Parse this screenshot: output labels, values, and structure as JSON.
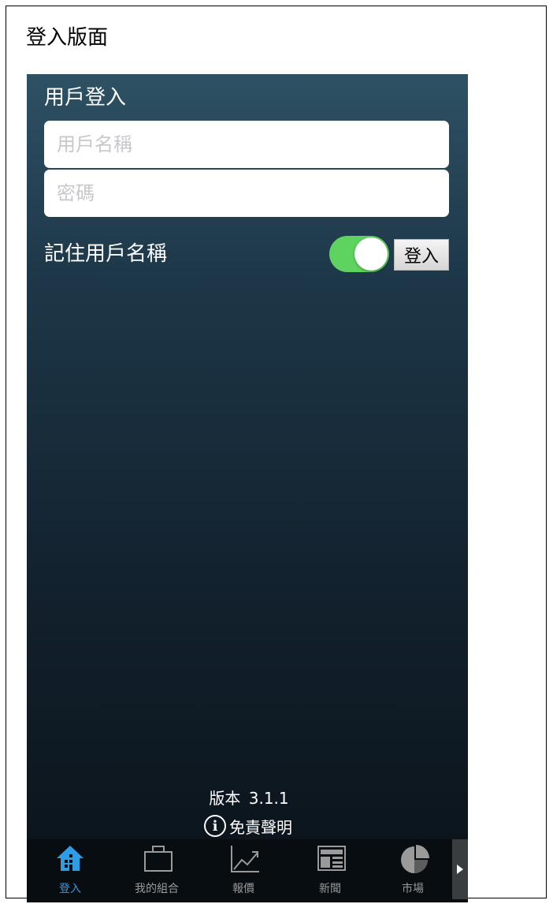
{
  "page": {
    "title": "登入版面"
  },
  "login": {
    "heading": "用戶登入",
    "username_placeholder": "用戶名稱",
    "password_placeholder": "密碼",
    "remember_label": "記住用戶名稱",
    "remember_enabled": true,
    "login_button": "登入"
  },
  "footer": {
    "version_label": "版本",
    "version_number": "3.1.1",
    "disclaimer": "免責聲明"
  },
  "tabs": [
    {
      "label": "登入",
      "icon": "house-icon",
      "active": true
    },
    {
      "label": "我的組合",
      "icon": "briefcase-icon",
      "active": false
    },
    {
      "label": "報價",
      "icon": "line-chart-icon",
      "active": false
    },
    {
      "label": "新聞",
      "icon": "newspaper-icon",
      "active": false
    },
    {
      "label": "市場",
      "icon": "pie-chart-icon",
      "active": false
    }
  ],
  "colors": {
    "accent": "#2f9de4",
    "toggle_on": "#5fd35f",
    "tab_inactive": "#9a9a9a",
    "background_top": "#2e5164",
    "background_bottom": "#0a1218"
  }
}
